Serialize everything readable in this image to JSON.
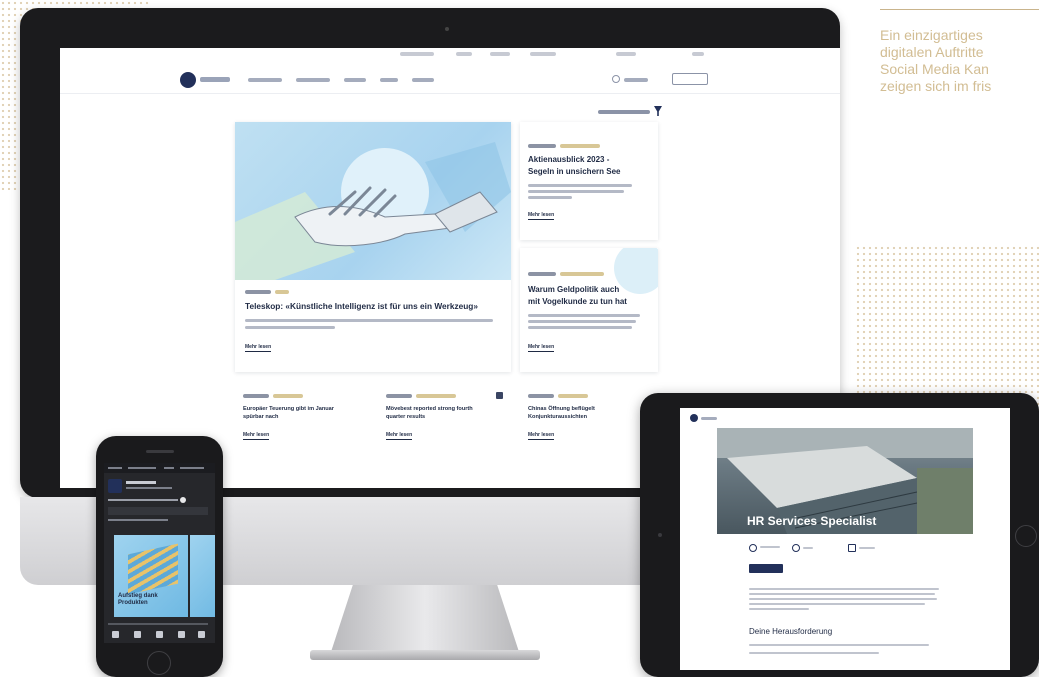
{
  "tagline": {
    "lines": [
      "Ein einzigartiges",
      "digitalen Auftritte",
      "Social Media Kan",
      "zeigen sich im fris"
    ]
  },
  "desktop_site": {
    "hero": {
      "headline": "Teleskop: «Künstliche Intelligenz ist für uns ein Werkzeug»",
      "more_label": "Mehr lesen"
    },
    "side_cards": [
      {
        "headline_line1": "Aktienausblick 2023 -",
        "headline_line2": "Segeln in unsichern See",
        "more_label": "Mehr lesen"
      },
      {
        "headline_line1": "Warum Geldpolitik auch",
        "headline_line2": "mit Vogelkunde zu tun hat",
        "more_label": "Mehr lesen"
      }
    ],
    "bottom_cards": [
      {
        "headline_line1": "Europäer Teuerung gibt im Januar",
        "headline_line2": "spürbar nach",
        "more_label": "Mehr lesen"
      },
      {
        "headline_line1": "Mövebest reported strong fourth",
        "headline_line2": "quarter results",
        "more_label": "Mehr lesen"
      },
      {
        "headline_line1": "Chinas Öffnung beflügelt",
        "headline_line2": "Konjunkturaussichten",
        "more_label": "Mehr lesen"
      }
    ]
  },
  "phone_post": {
    "caption_line1": "Aufstieg dank",
    "caption_line2": "Produkten"
  },
  "tablet_page": {
    "hero_title": "HR Services Specialist",
    "section_title": "Deine Herausforderung"
  }
}
